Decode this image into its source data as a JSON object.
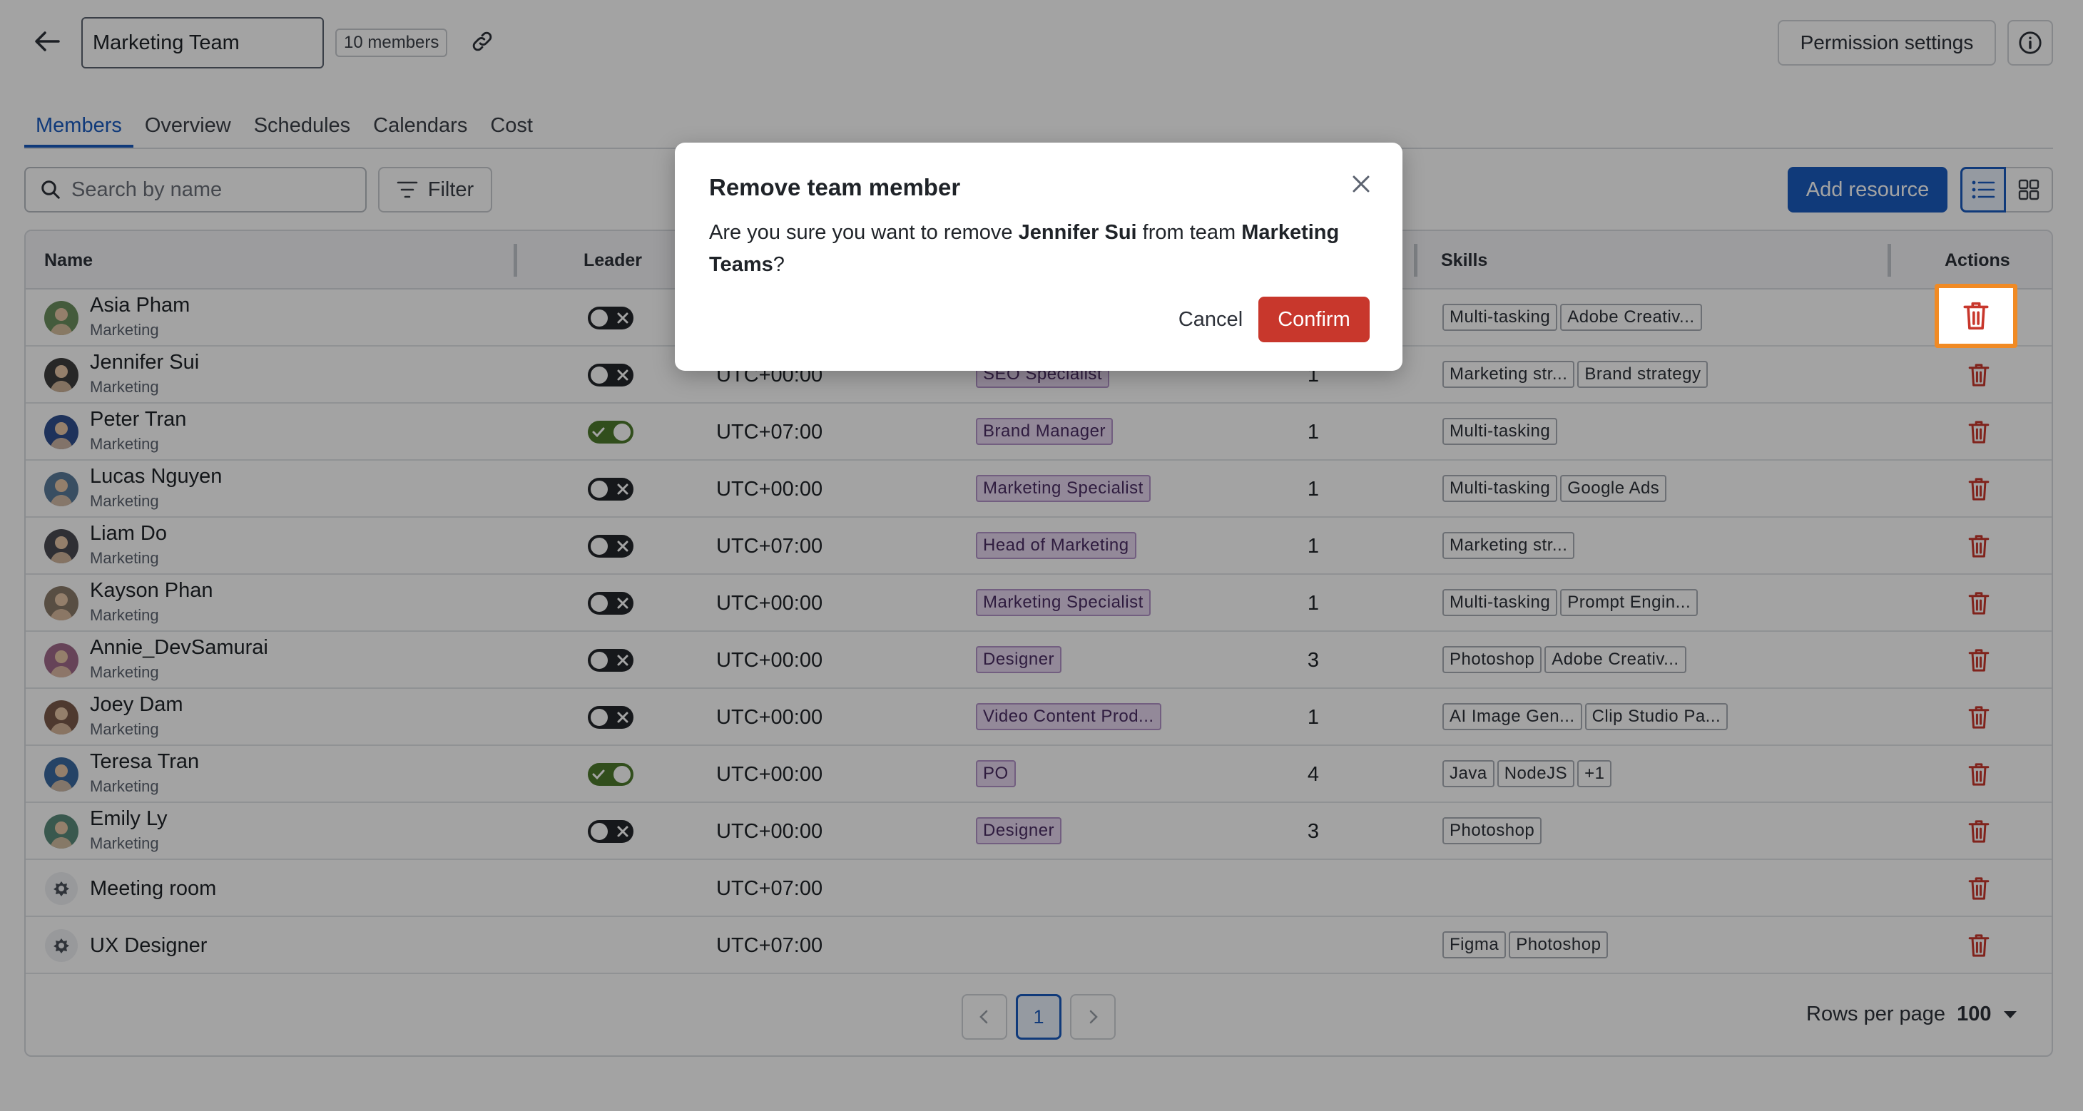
{
  "header": {
    "team_name": "Marketing Team",
    "member_count": "10 members",
    "permission_label": "Permission settings"
  },
  "tabs": [
    {
      "label": "Members",
      "active": true
    },
    {
      "label": "Overview"
    },
    {
      "label": "Schedules"
    },
    {
      "label": "Calendars"
    },
    {
      "label": "Cost"
    }
  ],
  "toolbar": {
    "search_placeholder": "Search by name",
    "filter_label": "Filter",
    "add_label": "Add resource"
  },
  "table": {
    "columns": {
      "name": "Name",
      "leader": "Leader",
      "skills": "Skills",
      "actions": "Actions"
    },
    "rows": [
      {
        "name": "Asia Pham",
        "dept": "Marketing",
        "leader": false,
        "tz": "",
        "role": "",
        "capacity": "",
        "skills": [
          "Multi-tasking",
          "Adobe Creativ..."
        ]
      },
      {
        "name": "Jennifer Sui",
        "dept": "Marketing",
        "leader": false,
        "tz": "UTC+00:00",
        "role": "SEO Specialist",
        "capacity": "1",
        "skills": [
          "Marketing str...",
          "Brand strategy"
        ]
      },
      {
        "name": "Peter Tran",
        "dept": "Marketing",
        "leader": true,
        "tz": "UTC+07:00",
        "role": "Brand Manager",
        "capacity": "1",
        "skills": [
          "Multi-tasking"
        ]
      },
      {
        "name": "Lucas Nguyen",
        "dept": "Marketing",
        "leader": false,
        "tz": "UTC+00:00",
        "role": "Marketing Specialist",
        "capacity": "1",
        "skills": [
          "Multi-tasking",
          "Google Ads"
        ]
      },
      {
        "name": "Liam Do",
        "dept": "Marketing",
        "leader": false,
        "tz": "UTC+07:00",
        "role": "Head of Marketing",
        "capacity": "1",
        "skills": [
          "Marketing str..."
        ]
      },
      {
        "name": "Kayson Phan",
        "dept": "Marketing",
        "leader": false,
        "tz": "UTC+00:00",
        "role": "Marketing Specialist",
        "capacity": "1",
        "skills": [
          "Multi-tasking",
          "Prompt Engin..."
        ]
      },
      {
        "name": "Annie_DevSamurai",
        "dept": "Marketing",
        "leader": false,
        "tz": "UTC+00:00",
        "role": "Designer",
        "capacity": "3",
        "skills": [
          "Photoshop",
          "Adobe Creativ..."
        ]
      },
      {
        "name": "Joey Dam",
        "dept": "Marketing",
        "leader": false,
        "tz": "UTC+00:00",
        "role": "Video Content Prod...",
        "capacity": "1",
        "skills": [
          "AI Image Gen...",
          "Clip Studio Pa..."
        ]
      },
      {
        "name": "Teresa Tran",
        "dept": "Marketing",
        "leader": true,
        "tz": "UTC+00:00",
        "role": "PO",
        "capacity": "4",
        "skills": [
          "Java",
          "NodeJS",
          "+1"
        ]
      },
      {
        "name": "Emily Ly",
        "dept": "Marketing",
        "leader": false,
        "tz": "UTC+00:00",
        "role": "Designer",
        "capacity": "3",
        "skills": [
          "Photoshop"
        ]
      },
      {
        "name": "Meeting room",
        "dept": "",
        "leader": null,
        "tz": "UTC+07:00",
        "role": "",
        "capacity": "",
        "skills": []
      },
      {
        "name": "UX Designer",
        "dept": "",
        "leader": null,
        "tz": "UTC+07:00",
        "role": "",
        "capacity": "",
        "skills": [
          "Figma",
          "Photoshop"
        ]
      }
    ]
  },
  "pagination": {
    "current_page": "1",
    "rows_per_page_label": "Rows per page",
    "rows_per_page_value": "100"
  },
  "dialog": {
    "title": "Remove team member",
    "text_prefix": "Are you sure you want to remove ",
    "member_name": "Jennifer Sui",
    "text_middle": " from team ",
    "team_name": "Marketing Teams",
    "text_suffix": "?",
    "cancel_label": "Cancel",
    "confirm_label": "Confirm"
  },
  "colors": {
    "accent": "#1a5bbf",
    "danger": "#c8372c",
    "highlight": "#f08a24",
    "role_bg": "#e6d6f0",
    "leader_on": "#4d7a2c"
  }
}
